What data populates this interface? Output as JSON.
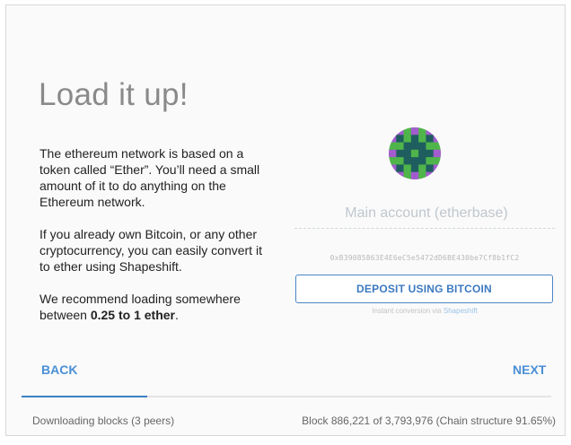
{
  "title": "Load it up!",
  "intro": {
    "p1": "The ethereum network is based on a token called “Ether”. You’ll need a small amount of it to do anything on the Ethereum network.",
    "p2": "If you already own Bitcoin, or any other cryptocurrency, you can easily convert it to ether using Shapeshift.",
    "p3_prefix": "We recommend loading somewhere between ",
    "p3_bold": "0.25 to 1 ether",
    "p3_suffix": "."
  },
  "account": {
    "placeholder": "Main account (etherbase)",
    "address": "0xB39085863E4E6eC5e5472dD6BE430be7Cf8b1fC2"
  },
  "deposit": {
    "button_label": "DEPOSIT USING BITCOIN",
    "instant_prefix": "Instant conversion via ",
    "instant_link": "Shapeshift"
  },
  "nav": {
    "back_label": "BACK",
    "next_label": "NEXT"
  },
  "progress": {
    "fraction": 0.238,
    "color": "#3a7fc4"
  },
  "status": {
    "left": "Downloading blocks (3 peers)",
    "right": "Block 886,221 of 3,793,976 (Chain structure 91.65%)"
  },
  "colors": {
    "accent": "#4a8fd6",
    "identicon_dark": "#1f5e5f",
    "identicon_green": "#4fb54a",
    "identicon_purple": "#a25ccd"
  }
}
